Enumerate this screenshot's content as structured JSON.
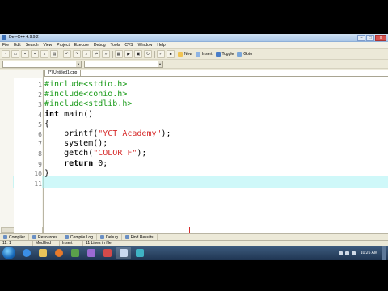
{
  "window": {
    "title": "Dev-C++ 4.9.9.2"
  },
  "menubar": [
    "File",
    "Edit",
    "Search",
    "View",
    "Project",
    "Execute",
    "Debug",
    "Tools",
    "CVS",
    "Window",
    "Help"
  ],
  "toolbar": {
    "new_label": "New",
    "insert_label": "Insert",
    "toggle_label": "Toggle",
    "goto_label": "Goto"
  },
  "editor": {
    "file_tab": "[*] Untitled1.cpp",
    "line_numbers": [
      "1",
      "2",
      "3",
      "4",
      "5",
      "6",
      "7",
      "8",
      "9",
      "10",
      "11"
    ],
    "lines": [
      [
        {
          "t": "#include<stdio.h>",
          "c": "pp"
        }
      ],
      [
        {
          "t": "#include<conio.h>",
          "c": "pp"
        }
      ],
      [
        {
          "t": "#include<stdlib.h>",
          "c": "pp"
        }
      ],
      [
        {
          "t": "int",
          "c": "kw"
        },
        {
          "t": " main()",
          "c": "plain"
        }
      ],
      [
        {
          "t": "{",
          "c": "plain"
        }
      ],
      [
        {
          "t": "    printf(",
          "c": "plain"
        },
        {
          "t": "\"YCT Academy\"",
          "c": "str"
        },
        {
          "t": ");",
          "c": "plain"
        }
      ],
      [
        {
          "t": "    system();",
          "c": "plain"
        }
      ],
      [
        {
          "t": "    getch(",
          "c": "plain"
        },
        {
          "t": "\"COLOR F\"",
          "c": "str"
        },
        {
          "t": ");",
          "c": "plain"
        }
      ],
      [
        {
          "t": "    ",
          "c": "plain"
        },
        {
          "t": "return",
          "c": "kw"
        },
        {
          "t": " 0;",
          "c": "plain"
        }
      ],
      [
        {
          "t": "}",
          "c": "plain"
        }
      ],
      [
        {
          "t": "",
          "c": "plain"
        }
      ]
    ],
    "active_line": 11
  },
  "bottom_tabs": [
    "Compiler",
    "Resources",
    "Compile Log",
    "Debug",
    "Find Results"
  ],
  "statusbar": {
    "position": "11: 1",
    "mode": "Modified",
    "insert": "Insert",
    "info": "11 Lines in file"
  },
  "taskbar": {
    "time": "10:26 AM",
    "date": ""
  },
  "colors": {
    "preprocessor": "#1a9b1a",
    "string": "#d62b2b",
    "active_line": "#a7f3f4"
  }
}
